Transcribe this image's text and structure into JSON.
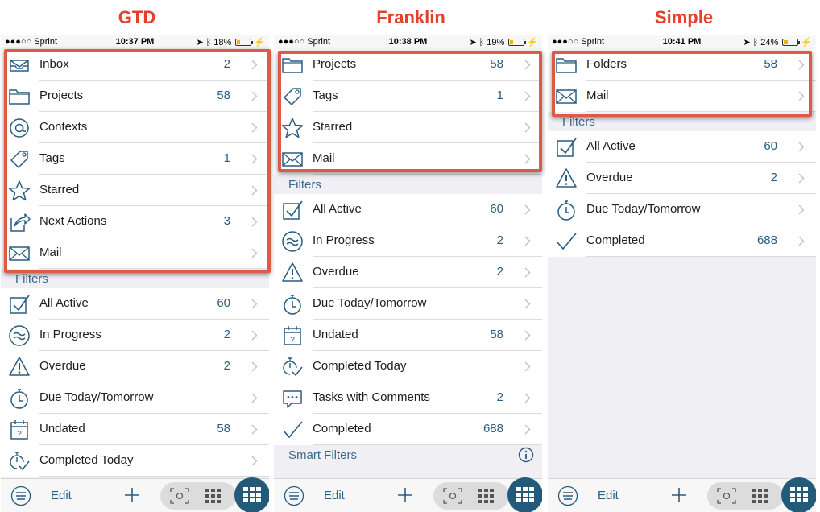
{
  "headings": {
    "gtd": "GTD",
    "franklin": "Franklin",
    "simple": "Simple"
  },
  "colors": {
    "heading": "#e4402a",
    "accent": "#2a5d80",
    "highlight": "#dc5a48",
    "section_bg": "#efeff4",
    "toolbar_button": "#235a7a"
  },
  "phones": {
    "gtd": {
      "status": {
        "carrier": "●●●○○ Sprint",
        "time": "10:37 PM",
        "battery": "18%",
        "battery_level": 0.18
      },
      "rows": [
        {
          "icon": "inbox-icon",
          "label": "Inbox",
          "count": "2"
        },
        {
          "icon": "folder-icon",
          "label": "Projects",
          "count": "58"
        },
        {
          "icon": "at-sign-icon",
          "label": "Contexts",
          "count": ""
        },
        {
          "icon": "tag-icon",
          "label": "Tags",
          "count": "1"
        },
        {
          "icon": "star-icon",
          "label": "Starred",
          "count": ""
        },
        {
          "icon": "next-action-icon",
          "label": "Next Actions",
          "count": "3"
        },
        {
          "icon": "envelope-icon",
          "label": "Mail",
          "count": ""
        }
      ],
      "filters_label": "Filters",
      "filters": [
        {
          "icon": "checkbox-icon",
          "label": "All Active",
          "count": "60"
        },
        {
          "icon": "in-progress-icon",
          "label": "In Progress",
          "count": "2"
        },
        {
          "icon": "warning-icon",
          "label": "Overdue",
          "count": "2"
        },
        {
          "icon": "stopwatch-icon",
          "label": "Due Today/Tomorrow",
          "count": ""
        },
        {
          "icon": "calendar-question-icon",
          "label": "Undated",
          "count": "58"
        },
        {
          "icon": "stopwatch-check-icon",
          "label": "Completed Today",
          "count": ""
        }
      ],
      "toolbar": {
        "edit": "Edit"
      }
    },
    "franklin": {
      "status": {
        "carrier": "●●●○○ Sprint",
        "time": "10:38 PM",
        "battery": "19%",
        "battery_level": 0.19
      },
      "rows": [
        {
          "icon": "folder-icon",
          "label": "Projects",
          "count": "58"
        },
        {
          "icon": "tag-icon",
          "label": "Tags",
          "count": "1"
        },
        {
          "icon": "star-icon",
          "label": "Starred",
          "count": ""
        },
        {
          "icon": "envelope-icon",
          "label": "Mail",
          "count": ""
        }
      ],
      "filters_label": "Filters",
      "filters": [
        {
          "icon": "checkbox-icon",
          "label": "All Active",
          "count": "60"
        },
        {
          "icon": "in-progress-icon",
          "label": "In Progress",
          "count": "2"
        },
        {
          "icon": "warning-icon",
          "label": "Overdue",
          "count": "2"
        },
        {
          "icon": "stopwatch-icon",
          "label": "Due Today/Tomorrow",
          "count": ""
        },
        {
          "icon": "calendar-question-icon",
          "label": "Undated",
          "count": "58"
        },
        {
          "icon": "stopwatch-check-icon",
          "label": "Completed Today",
          "count": ""
        },
        {
          "icon": "comment-icon",
          "label": "Tasks with Comments",
          "count": "2"
        },
        {
          "icon": "checkmark-icon",
          "label": "Completed",
          "count": "688"
        }
      ],
      "smart_filters_label": "Smart Filters",
      "toolbar": {
        "edit": "Edit"
      }
    },
    "simple": {
      "status": {
        "carrier": "●●●○○ Sprint",
        "time": "10:41 PM",
        "battery": "24%",
        "battery_level": 0.24
      },
      "rows": [
        {
          "icon": "folder-icon",
          "label": "Folders",
          "count": "58"
        },
        {
          "icon": "envelope-icon",
          "label": "Mail",
          "count": ""
        }
      ],
      "filters_label": "Filters",
      "filters": [
        {
          "icon": "checkbox-icon",
          "label": "All Active",
          "count": "60"
        },
        {
          "icon": "warning-icon",
          "label": "Overdue",
          "count": "2"
        },
        {
          "icon": "stopwatch-icon",
          "label": "Due Today/Tomorrow",
          "count": ""
        },
        {
          "icon": "checkmark-icon",
          "label": "Completed",
          "count": "688"
        }
      ],
      "toolbar": {
        "edit": "Edit"
      }
    }
  }
}
